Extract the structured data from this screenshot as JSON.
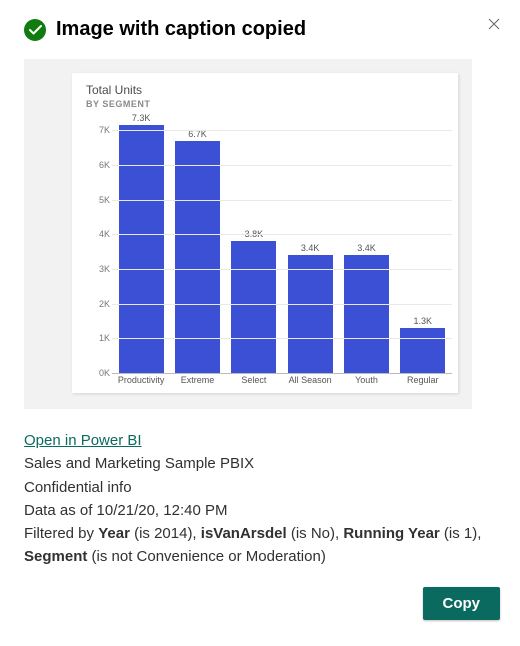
{
  "header": {
    "title": "Image with caption copied",
    "success_icon": "check-circle",
    "close_icon": "close-x"
  },
  "chart_data": {
    "type": "bar",
    "title": "Total Units",
    "subtitle": "BY SEGMENT",
    "xlabel": "",
    "ylabel": "",
    "ylim": [
      0,
      7500
    ],
    "y_ticks": [
      "0K",
      "1K",
      "2K",
      "3K",
      "4K",
      "5K",
      "6K",
      "7K"
    ],
    "categories": [
      "Productivity",
      "Extreme",
      "Select",
      "All Season",
      "Youth",
      "Regular"
    ],
    "values": [
      7300,
      6700,
      3800,
      3400,
      3400,
      1300
    ],
    "data_labels": [
      "7.3K",
      "6.7K",
      "3.8K",
      "3.4K",
      "3.4K",
      "1.3K"
    ],
    "bar_color": "#3b50d4"
  },
  "caption": {
    "link_text": "Open in Power BI",
    "report_name": "Sales and Marketing Sample PBIX",
    "classification": "Confidential info",
    "as_of": "Data as of 10/21/20, 12:40 PM",
    "filters": {
      "prefix": "Filtered by ",
      "year_label": "Year",
      "year_val": " (is 2014), ",
      "vanarsdel_label": "isVanArsdel",
      "vanarsdel_val": " (is No), ",
      "running_year_label": "Running Year",
      "running_year_val": " (is 1), ",
      "segment_label": "Segment",
      "segment_val": " (is not Convenience or Moderation)"
    }
  },
  "footer": {
    "copy_label": "Copy"
  }
}
